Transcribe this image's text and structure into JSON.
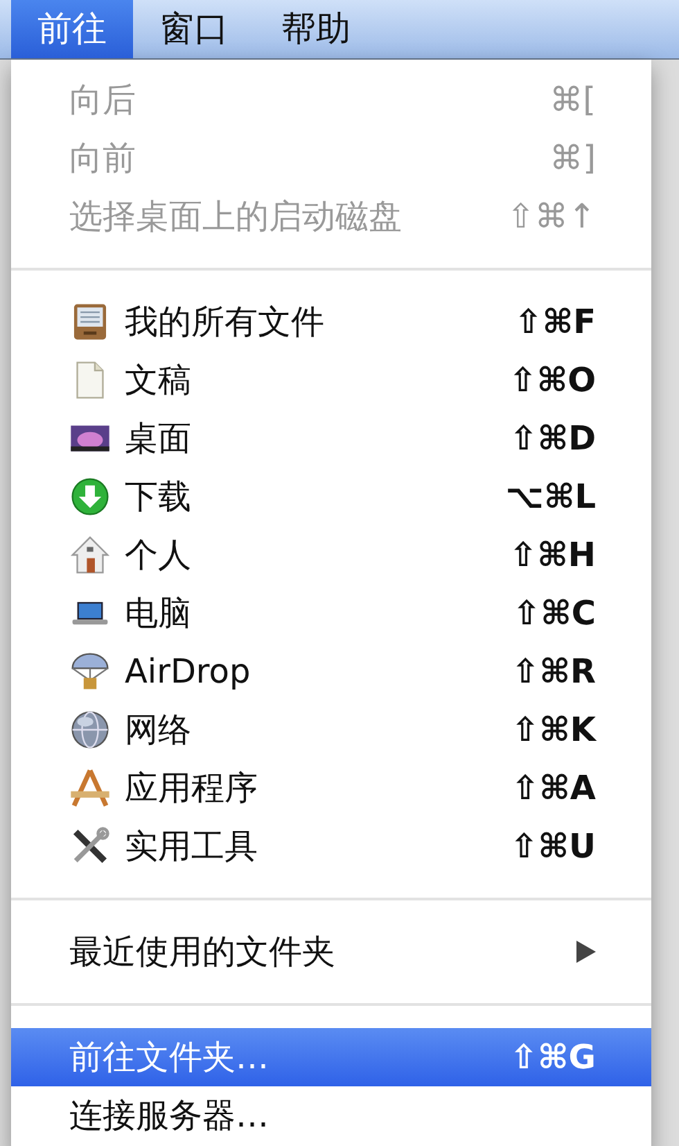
{
  "menubar": [
    {
      "label": "前往",
      "selected": true
    },
    {
      "label": "窗口",
      "selected": false
    },
    {
      "label": "帮助",
      "selected": false
    }
  ],
  "menu": {
    "sections": [
      {
        "kind": "plain",
        "items": [
          {
            "label": "向后",
            "shortcut": "⌘[",
            "disabled": true,
            "selected": false,
            "kind": "command"
          },
          {
            "label": "向前",
            "shortcut": "⌘]",
            "disabled": true,
            "selected": false,
            "kind": "command"
          },
          {
            "label": "选择桌面上的启动磁盘",
            "shortcut": "⇧⌘↑",
            "disabled": true,
            "selected": false,
            "kind": "command"
          }
        ]
      },
      {
        "kind": "places",
        "items": [
          {
            "label": "我的所有文件",
            "shortcut": "⇧⌘F",
            "disabled": false,
            "selected": false,
            "kind": "command"
          },
          {
            "label": "文稿",
            "shortcut": "⇧⌘O",
            "disabled": false,
            "selected": false,
            "kind": "command"
          },
          {
            "label": "桌面",
            "shortcut": "⇧⌘D",
            "disabled": false,
            "selected": false,
            "kind": "command"
          },
          {
            "label": "下载",
            "shortcut": "⌥⌘L",
            "disabled": false,
            "selected": false,
            "kind": "command"
          },
          {
            "label": "个人",
            "shortcut": "⇧⌘H",
            "disabled": false,
            "selected": false,
            "kind": "command"
          },
          {
            "label": "电脑",
            "shortcut": "⇧⌘C",
            "disabled": false,
            "selected": false,
            "kind": "command"
          },
          {
            "label": "AirDrop",
            "shortcut": "⇧⌘R",
            "disabled": false,
            "selected": false,
            "kind": "command"
          },
          {
            "label": "网络",
            "shortcut": "⇧⌘K",
            "disabled": false,
            "selected": false,
            "kind": "command"
          },
          {
            "label": "应用程序",
            "shortcut": "⇧⌘A",
            "disabled": false,
            "selected": false,
            "kind": "command"
          },
          {
            "label": "实用工具",
            "shortcut": "⇧⌘U",
            "disabled": false,
            "selected": false,
            "kind": "command"
          }
        ]
      },
      {
        "kind": "plain",
        "items": [
          {
            "label": "最近使用的文件夹",
            "disabled": false,
            "selected": false,
            "kind": "submenu"
          }
        ]
      },
      {
        "kind": "plain",
        "items": [
          {
            "label": "前往文件夹…",
            "shortcut": "⇧⌘G",
            "disabled": false,
            "selected": true,
            "kind": "command"
          },
          {
            "label": "连接服务器…",
            "disabled": false,
            "selected": false,
            "kind": "command"
          }
        ]
      }
    ]
  }
}
